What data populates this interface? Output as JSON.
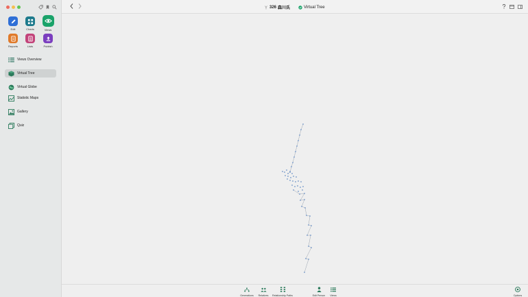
{
  "window": {
    "title_number": "326",
    "title_name": "森川氏",
    "view_name": "Virtual Tree"
  },
  "apps": [
    {
      "label": "Edit",
      "color": "#2f6fd6",
      "icon": "pencil-icon"
    },
    {
      "label": "Charts",
      "color": "#1d7a8c",
      "icon": "charts-icon"
    },
    {
      "label": "Views",
      "color": "#1aa36a",
      "icon": "eye-icon"
    },
    {
      "label": "Reports",
      "color": "#e07a2a",
      "icon": "reports-icon"
    },
    {
      "label": "Lists",
      "color": "#c2437a",
      "icon": "lists-icon"
    },
    {
      "label": "Publish",
      "color": "#7b3fbf",
      "icon": "publish-icon"
    }
  ],
  "nav": [
    {
      "label": "Views Overview",
      "icon": "list-icon",
      "active": false
    },
    {
      "label": "Virtual Tree",
      "icon": "tree-globe-icon",
      "active": true
    },
    {
      "label": "Virtual Globe",
      "icon": "globe-icon",
      "active": false
    },
    {
      "label": "Statistic Maps",
      "icon": "map-icon",
      "active": false
    },
    {
      "label": "Gallery",
      "icon": "gallery-icon",
      "active": false
    },
    {
      "label": "Quiz",
      "icon": "quiz-icon",
      "active": false
    }
  ],
  "bottom": {
    "generations": "Generations",
    "relatives": "Relatives",
    "relationship_paths": "Relationship Paths",
    "edit_person": "Edit Person",
    "views": "Views",
    "options": "Options"
  },
  "colors": {
    "accent": "#1aa36a",
    "tree_node": "#6f95c9",
    "tree_line": "#9aa4b0"
  }
}
